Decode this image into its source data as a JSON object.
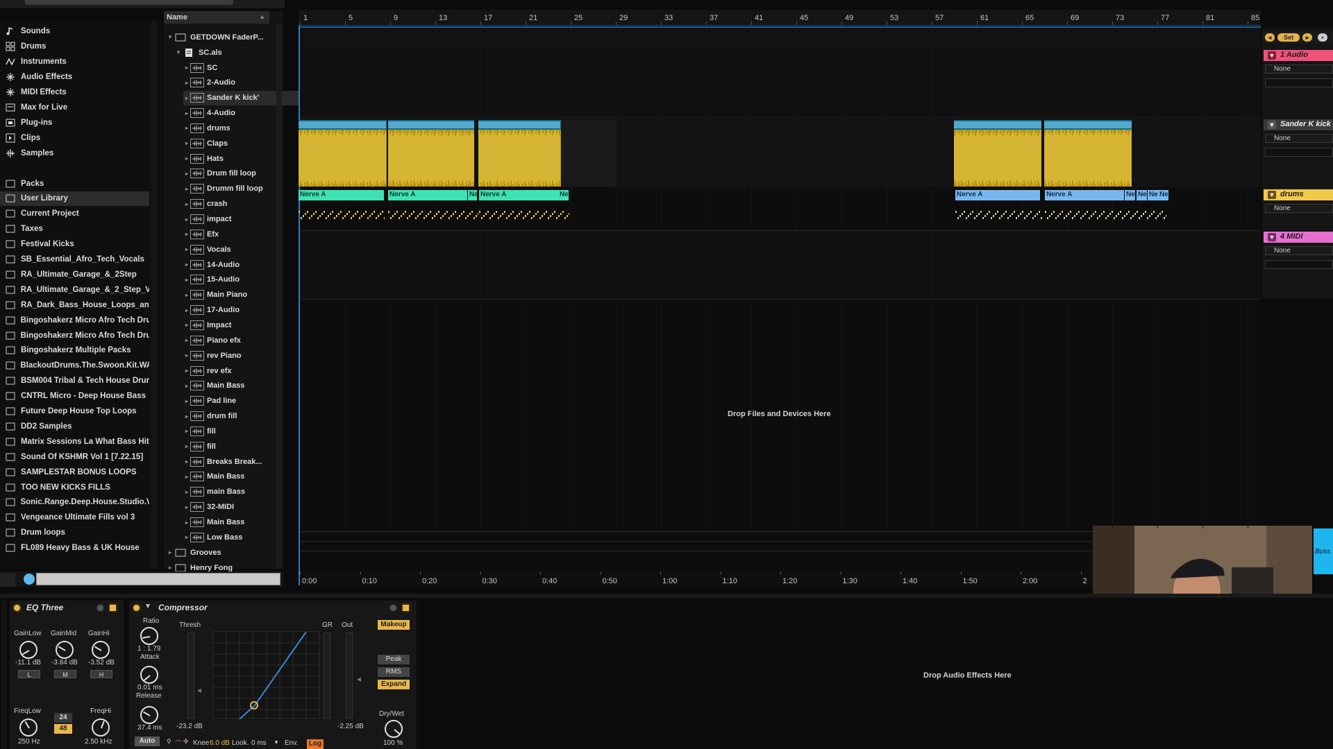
{
  "browser": {
    "categories": [
      "Sounds",
      "Drums",
      "Instruments",
      "Audio Effects",
      "MIDI Effects",
      "Max for Live",
      "Plug-ins",
      "Clips",
      "Samples"
    ],
    "places": [
      "Packs",
      "User Library",
      "Current Project",
      "Taxes",
      "Festival Kicks",
      "SB_Essential_Afro_Tech_Vocals",
      "RA_Ultimate_Garage_&_2Step",
      "RA_Ultimate_Garage_&_2_Step_V",
      "RA_Dark_Bass_House_Loops_an",
      "Bingoshakerz Micro Afro Tech Dru",
      "Bingoshakerz Micro Afro Tech Dru",
      "Bingoshakerz Multiple Packs",
      "BlackoutDrums.The.Swoon.Kit.WA",
      "BSM004 Tribal & Tech House Drur",
      "CNTRL Micro - Deep House Bass",
      "Future Deep House Top Loops",
      "DD2 Samples",
      "Matrix Sessions La What Bass Hit",
      "Sound Of KSHMR Vol 1 [7.22.15]",
      "SAMPLESTAR BONUS LOOPS",
      "TOO NEW KICKS FILLS",
      "Sonic.Range.Deep.House.Studio.V",
      "Vengeance Ultimate Fills vol 3",
      "Drum loops",
      "FL089 Heavy Bass & UK House"
    ],
    "name_header": "Name",
    "root_folder": "GETDOWN FaderP...",
    "set_file": "SC.als",
    "tracks": [
      "SC",
      "2-Audio",
      "Sander K kick'",
      "4-Audio",
      "drums",
      "Claps",
      "Hats",
      "Drum fill loop",
      "Drumm fill loop",
      "crash",
      "impact",
      "Efx",
      "Vocals",
      "14-Audio",
      "15-Audio",
      "Main Piano",
      "17-Audio",
      "Impact",
      "Piano efx",
      "rev Piano",
      "rev efx",
      "Main Bass",
      "Pad line",
      "drum fill",
      "fill",
      "fill",
      "Breaks Break...",
      "Main Bass",
      "main Bass",
      "32-MIDI",
      "Main Bass",
      "Low Bass"
    ],
    "bottom_folders": [
      "Grooves",
      "Henry Fong"
    ]
  },
  "arrangement": {
    "bar_numbers": [
      "1",
      "5",
      "9",
      "13",
      "17",
      "21",
      "25",
      "29",
      "33",
      "37",
      "41",
      "45",
      "49",
      "53",
      "57",
      "61",
      "65",
      "69",
      "73",
      "77",
      "81",
      "85"
    ],
    "time_labels": [
      "0:00",
      "0:10",
      "0:20",
      "0:30",
      "0:40",
      "0:50",
      "1:00",
      "1:10",
      "1:20",
      "1:30",
      "1:40",
      "1:50",
      "2:00",
      "2"
    ],
    "drop_files_text": "Drop Files and Devices Here",
    "midi_clips": [
      {
        "label": "Nerve A",
        "color": "#3ee2b4"
      },
      {
        "label": "Nerve A",
        "color": "#3ee2b4"
      },
      {
        "label": "Ne",
        "color": "#3ee2b4"
      },
      {
        "label": "Nerve A",
        "color": "#3ee2b4"
      },
      {
        "label": "Ne",
        "color": "#3ee2b4"
      },
      {
        "label": "Nerve A",
        "color": "#79b8ee"
      },
      {
        "label": "Nerve A",
        "color": "#79b8ee"
      },
      {
        "label": "Ne",
        "color": "#79b8ee"
      },
      {
        "label": "Ne",
        "color": "#79b8ee"
      },
      {
        "label": "Ne",
        "color": "#79b8ee"
      },
      {
        "label": "Ne",
        "color": "#79b8ee"
      }
    ]
  },
  "mixer": {
    "set_label": "Set",
    "tracks": [
      {
        "name": "1 Audio",
        "color": "#f0527a",
        "input": "None"
      },
      {
        "name": "Sander K kick",
        "color": "#3a3a3a",
        "input": "None"
      },
      {
        "name": "drums",
        "color": "#f2c94c",
        "input": "None"
      },
      {
        "name": "4 MIDI",
        "color": "#e86fd2",
        "input": "None"
      }
    ],
    "right_buss_label": "Buss"
  },
  "devices": {
    "eq": {
      "title": "EQ Three",
      "gain_low_label": "GainLow",
      "gain_mid_label": "GainMid",
      "gain_hi_label": "GainHi",
      "gain_low": "-11.1 dB",
      "gain_mid": "-3.84 dB",
      "gain_hi": "-3.52 dB",
      "l_btn": "L",
      "m_btn": "M",
      "h_btn": "H",
      "freq_low_label": "FreqLow",
      "freq_hi_label": "FreqHi",
      "freq_low": "250 Hz",
      "freq_hi": "2.50 kHz",
      "slope_24": "24",
      "slope_48": "48"
    },
    "compressor": {
      "title": "Compressor",
      "ratio_label": "Ratio",
      "ratio": "1 : 1.79",
      "attack_label": "Attack",
      "attack": "0.01 ms",
      "release_label": "Release",
      "release": "37.4 ms",
      "auto_btn": "Auto",
      "thresh_label": "Thresh",
      "thresh_val": "-23.2 dB",
      "gr_label": "GR",
      "out_label": "Out",
      "out_val": "-2.25 dB",
      "makeup_btn": "Makeup",
      "peak_btn": "Peak",
      "rms_btn": "RMS",
      "expand_btn": "Expand",
      "drywet_label": "Dry/Wet",
      "drywet": "100 %",
      "knee_label": "Knee",
      "knee": "6.0 dB",
      "look_label": "Look.",
      "look": "0 ms",
      "env_label": "Env.",
      "log_btn": "Log"
    },
    "drop_effects_text": "Drop Audio Effects Here"
  },
  "colors": {
    "accent_blue": "#2e7cc0",
    "clip_wave": "#b8930f",
    "clip_head": "#0e6e96",
    "midi_green": "#3ee2b4",
    "midi_blue": "#79b8ee",
    "device_orange": "#e8b74a"
  }
}
